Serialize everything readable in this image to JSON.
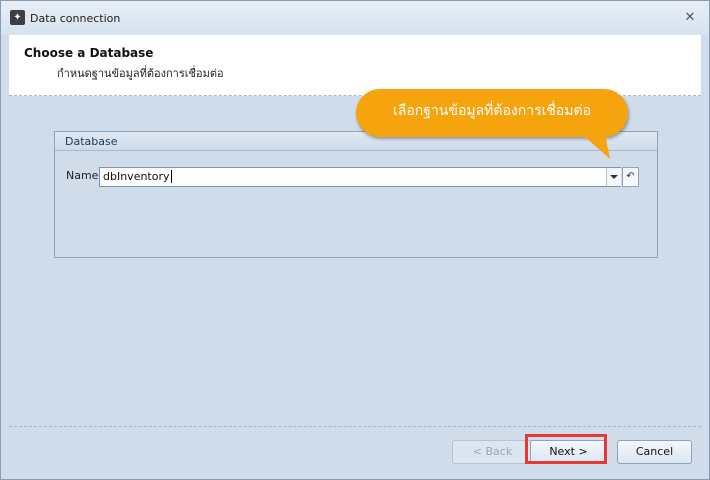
{
  "window": {
    "title": "Data connection",
    "app_icon": "wizard-app-icon",
    "close_glyph": "✖"
  },
  "header": {
    "title": "Choose a Database",
    "subtitle": "กำหนดฐานข้อมูลที่ต้องการเชื่อมต่อ"
  },
  "callout": {
    "text": "เลือกฐานข้อมูลที่ต้องการเชื่อมต่อ",
    "color": "#f5a40d"
  },
  "database_group": {
    "title": "Database",
    "name_label": "Name",
    "name_value": "dbInventory"
  },
  "footer": {
    "back_label": "< Back",
    "next_label": "Next >",
    "cancel_label": "Cancel"
  },
  "colors": {
    "background": "#d0dcea",
    "highlight": "#e53935"
  }
}
